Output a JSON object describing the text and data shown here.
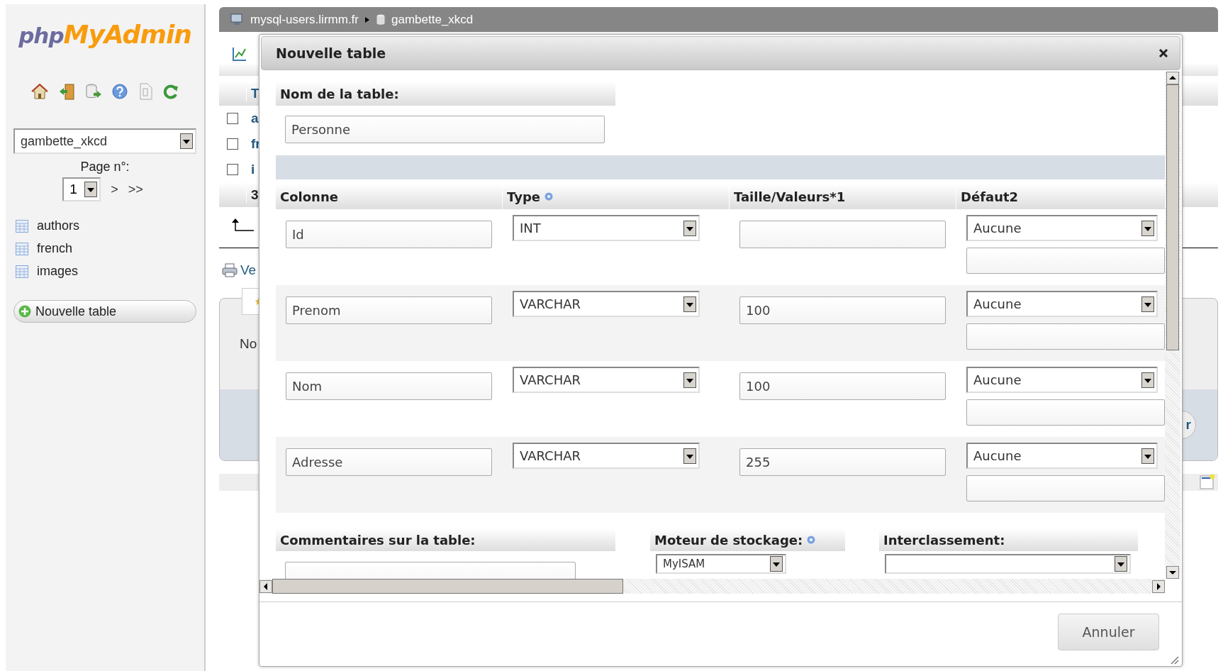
{
  "sidebar": {
    "logo": {
      "left": "php",
      "right": "MyAdmin"
    },
    "database_select": {
      "value": "gambette_xkcd"
    },
    "page_label": "Page n°:",
    "page_select": {
      "value": "1"
    },
    "page_next": ">",
    "page_last": ">>",
    "tables": [
      {
        "name": "authors"
      },
      {
        "name": "french"
      },
      {
        "name": "images"
      }
    ],
    "new_table_button": "Nouvelle table"
  },
  "breadcrumb": [
    {
      "kind": "server",
      "label": "mysql-users.lirmm.fr"
    },
    {
      "kind": "database",
      "label": "gambette_xkcd"
    }
  ],
  "background": {
    "table_header": "T",
    "rows": [
      {
        "label": "a",
        "checked": false
      },
      {
        "label": "fr",
        "checked": false
      },
      {
        "label": "i",
        "checked": false
      }
    ],
    "footer": "3",
    "print_link": "Ve",
    "panel_text": "No",
    "panel_button": "r"
  },
  "dialog": {
    "title": "Nouvelle table",
    "table_name_label": "Nom de la table:",
    "table_name": "Personne",
    "columns": [
      {
        "label": "Colonne",
        "help": false
      },
      {
        "label": "Type",
        "help": true
      },
      {
        "label": "Taille/Valeurs*1",
        "help": false
      },
      {
        "label": "Défaut2",
        "help": false
      }
    ],
    "fields": [
      {
        "name": "Id",
        "type": "INT",
        "default": "Aucune"
      },
      {
        "name": "Prenom",
        "type": "VARCHAR",
        "size": "100",
        "default": "Aucune"
      },
      {
        "name": "Nom",
        "type": "VARCHAR",
        "size": "100",
        "default": "Aucune"
      },
      {
        "name": "Adresse",
        "type": "VARCHAR",
        "size": "255",
        "default": "Aucune"
      }
    ],
    "options": [
      {
        "label": "Commentaires sur la table:",
        "kind": "text",
        "help": false
      },
      {
        "label": "Moteur de stockage:",
        "kind": "select",
        "help": true,
        "value": "MyISAM"
      },
      {
        "label": "Interclassement:",
        "kind": "select",
        "help": false
      }
    ],
    "cancel_button": "Annuler"
  }
}
